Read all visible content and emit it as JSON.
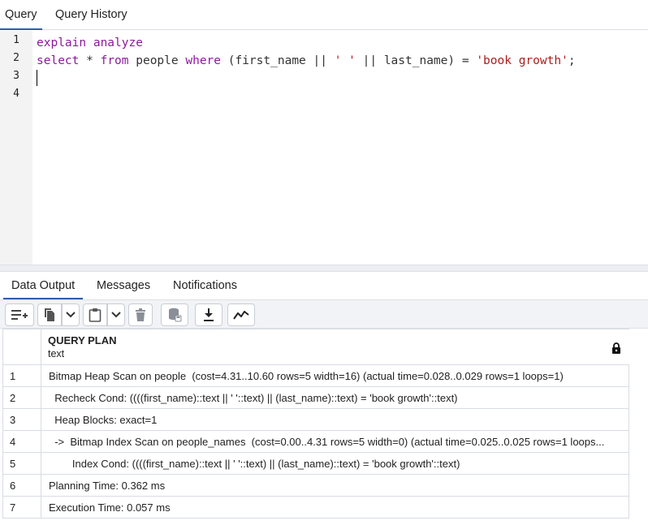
{
  "top_tabs": [
    {
      "label": "Query"
    },
    {
      "label": "Query History"
    }
  ],
  "editor": {
    "line_numbers": [
      "1",
      "2",
      "3",
      "4"
    ],
    "line1": {
      "kw1": "explain",
      "kw2": "analyze"
    },
    "line2": {
      "kw_select": "select",
      "star": " * ",
      "kw_from": "from",
      "people": " people ",
      "kw_where": "where",
      "expr": " (first_name || ",
      "space_str": "' '",
      "concat": " || last_name) = ",
      "value_str": "'book growth'",
      "semi": ";"
    }
  },
  "bottom_tabs": [
    {
      "label": "Data Output"
    },
    {
      "label": "Messages"
    },
    {
      "label": "Notifications"
    }
  ],
  "toolbar": {
    "icons": [
      "add-row-icon",
      "copy-icon",
      "dropdown-icon",
      "paste-icon",
      "dropdown-icon",
      "delete-icon",
      "save-data-icon",
      "download-icon",
      "graph-icon"
    ]
  },
  "grid": {
    "column": {
      "name": "QUERY PLAN",
      "type": "text"
    },
    "rows": [
      {
        "num": "1",
        "value": "Bitmap Heap Scan on people  (cost=4.31..10.60 rows=5 width=16) (actual time=0.028..0.029 rows=1 loops=1)"
      },
      {
        "num": "2",
        "value": "  Recheck Cond: ((((first_name)::text || ' '::text) || (last_name)::text) = 'book growth'::text)"
      },
      {
        "num": "3",
        "value": "  Heap Blocks: exact=1"
      },
      {
        "num": "4",
        "value": "  ->  Bitmap Index Scan on people_names  (cost=0.00..4.31 rows=5 width=0) (actual time=0.025..0.025 rows=1 loops..."
      },
      {
        "num": "5",
        "value": "        Index Cond: ((((first_name)::text || ' '::text) || (last_name)::text) = 'book growth'::text)"
      },
      {
        "num": "6",
        "value": "Planning Time: 0.362 ms"
      },
      {
        "num": "7",
        "value": "Execution Time: 0.057 ms"
      }
    ]
  }
}
